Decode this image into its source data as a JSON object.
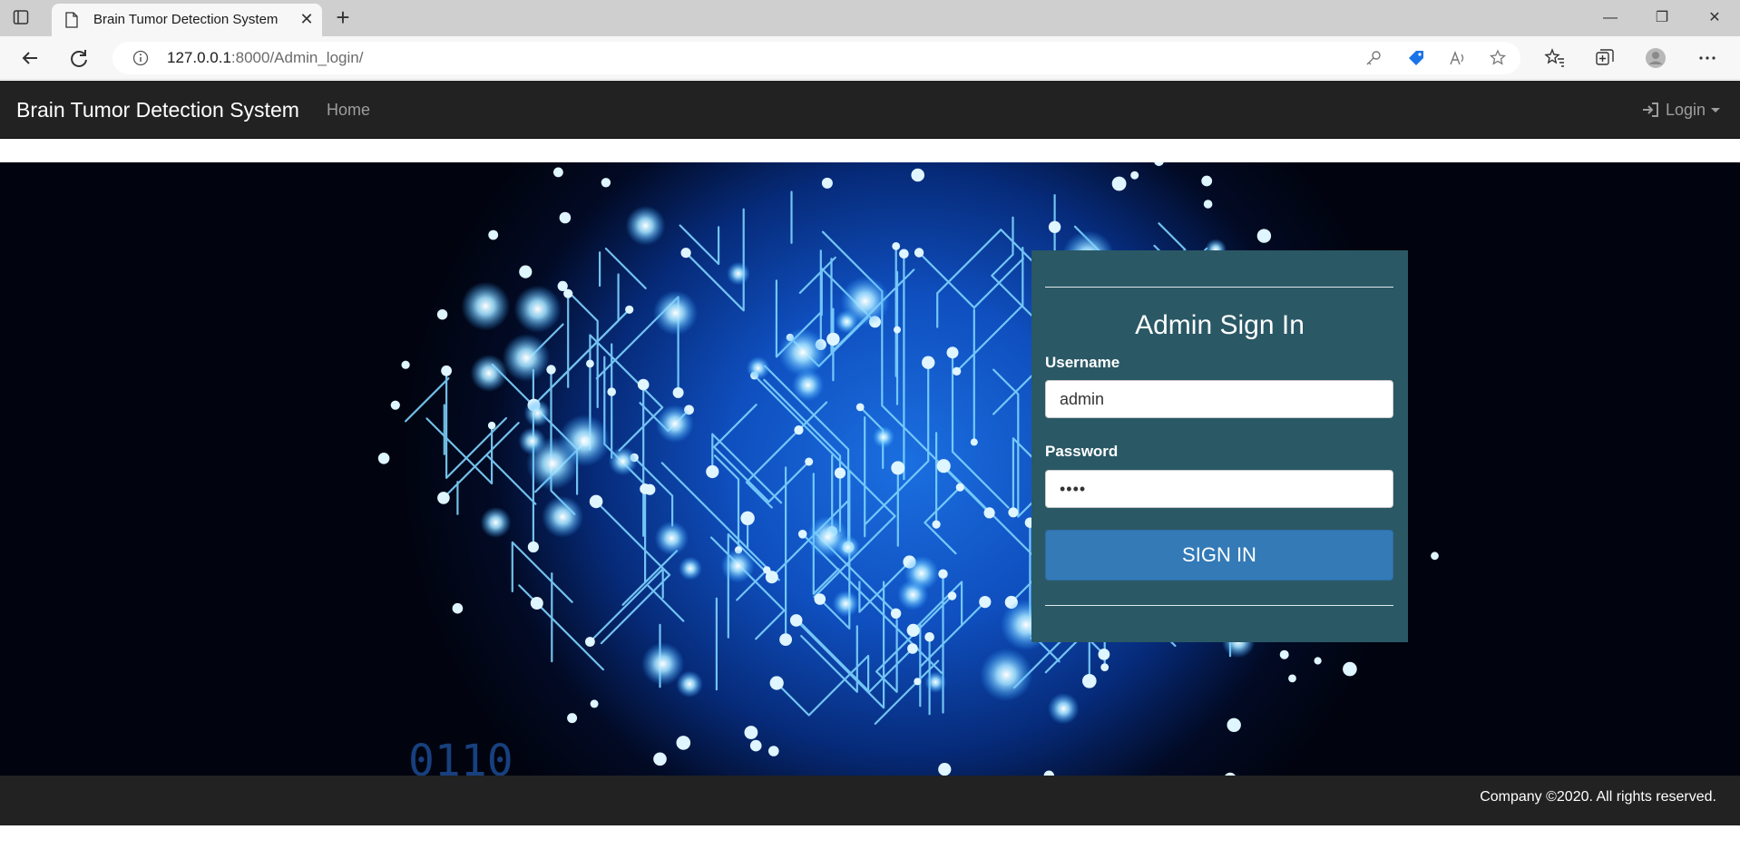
{
  "browser": {
    "tab_title": "Brain Tumor Detection System",
    "url_host": "127.0.0.1",
    "url_path": ":8000/Admin_login/"
  },
  "navbar": {
    "brand": "Brain Tumor Detection System",
    "home": "Home",
    "login": "Login"
  },
  "login_form": {
    "title": "Admin Sign In",
    "username_label": "Username",
    "username_value": "admin",
    "password_label": "Password",
    "password_value": "••••",
    "submit_label": "SIGN IN"
  },
  "hero": {
    "binary_text": "0110"
  },
  "footer": {
    "copyright": "Company ©2020. All rights reserved."
  },
  "colors": {
    "navbar_bg": "#222222",
    "panel_bg": "#2a5865",
    "button_bg": "#337ab7",
    "hero_glow": "#1b6fe0"
  }
}
